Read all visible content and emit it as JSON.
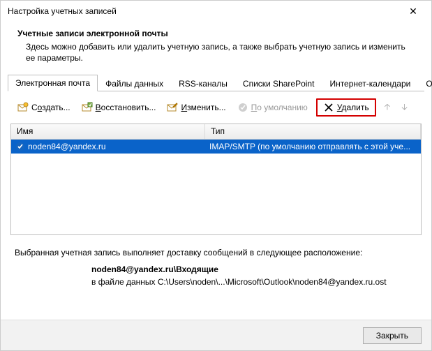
{
  "window": {
    "title": "Настройка учетных записей",
    "close_glyph": "✕"
  },
  "header": {
    "title": "Учетные записи электронной почты",
    "description": "Здесь можно добавить или удалить учетную запись, а также выбрать учетную запись и изменить ее параметры."
  },
  "tabs": {
    "items": [
      {
        "label": "Электронная почта"
      },
      {
        "label": "Файлы данных"
      },
      {
        "label": "RSS-каналы"
      },
      {
        "label": "Списки SharePoint"
      },
      {
        "label": "Интернет-календари"
      },
      {
        "label": "Опублико"
      }
    ],
    "arrow_left": "◂",
    "arrow_right": "▸"
  },
  "toolbar": {
    "create_prefix": "С",
    "create_u": "о",
    "create_suffix": "здать...",
    "restore_prefix": "",
    "restore_u": "В",
    "restore_suffix": "осстановить...",
    "edit_prefix": "",
    "edit_u": "И",
    "edit_suffix": "зменить...",
    "default_prefix": "",
    "default_u": "П",
    "default_suffix": "о умолчанию",
    "delete_prefix": "",
    "delete_u": "У",
    "delete_suffix": "далить",
    "arrow_up": "🡡",
    "arrow_down": "🡣"
  },
  "grid": {
    "col_name": "Имя",
    "col_type": "Тип",
    "rows": [
      {
        "name": "noden84@yandex.ru",
        "type": "IMAP/SMTP (по умолчанию отправлять с этой уче..."
      }
    ]
  },
  "delivery": {
    "intro": "Выбранная учетная запись выполняет доставку сообщений в следующее расположение:",
    "bold_line": "noden84@yandex.ru\\Входящие",
    "path_line": "в файле данных C:\\Users\\noden\\...\\Microsoft\\Outlook\\noden84@yandex.ru.ost"
  },
  "footer": {
    "close_prefix": "",
    "close_u": "З",
    "close_suffix": "акрыть"
  }
}
